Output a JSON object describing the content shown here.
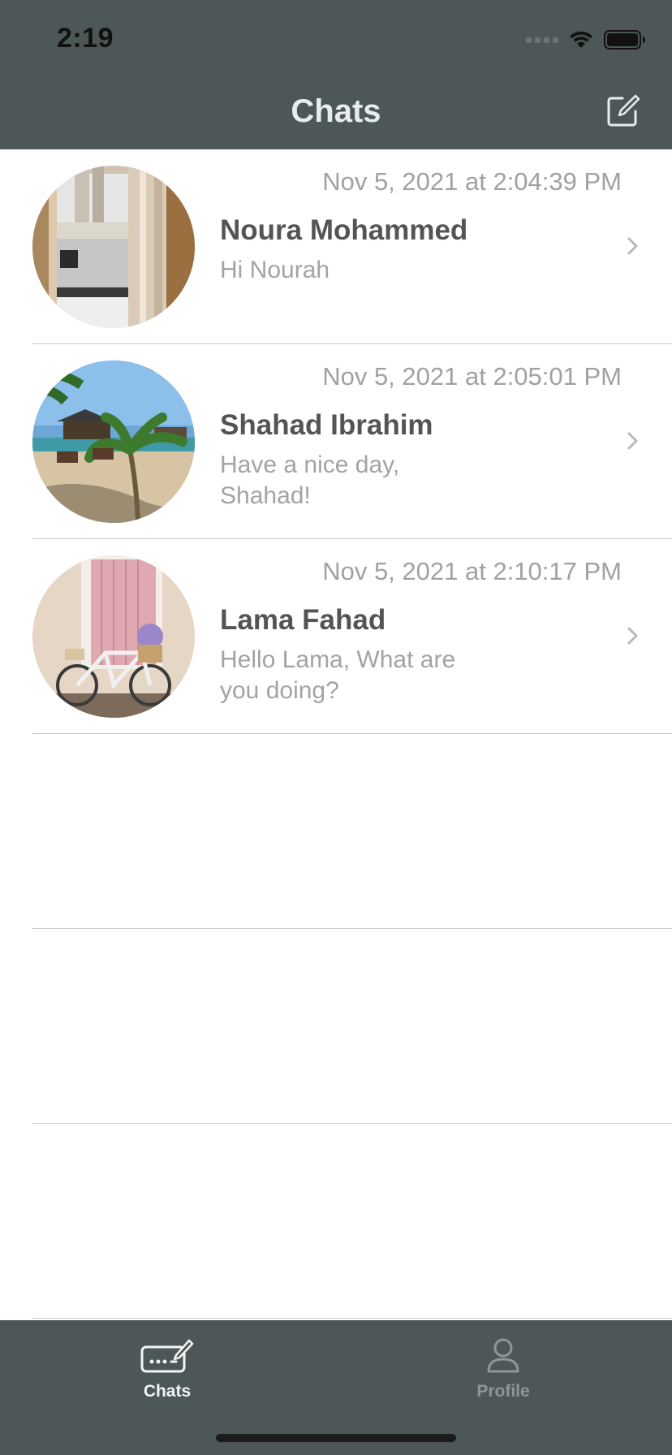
{
  "status_bar": {
    "time": "2:19"
  },
  "nav": {
    "title": "Chats",
    "compose_icon": "compose-icon"
  },
  "chats": [
    {
      "timestamp": "Nov 5, 2021 at 2:04:39 PM",
      "name": "Noura Mohammed",
      "message": "Hi Nourah"
    },
    {
      "timestamp": "Nov 5, 2021 at 2:05:01 PM",
      "name": "Shahad Ibrahim",
      "message": "Have a nice day, Shahad!"
    },
    {
      "timestamp": "Nov 5, 2021 at 2:10:17 PM",
      "name": "Lama Fahad",
      "message": "Hello Lama, What are you doing?"
    }
  ],
  "tab_bar": {
    "tabs": [
      {
        "label": "Chats",
        "icon": "chat-keyboard-icon",
        "selected": true
      },
      {
        "label": "Profile",
        "icon": "person-icon",
        "selected": false
      }
    ]
  },
  "colors": {
    "bar_background": "#4d5757",
    "title_text": "#e9ecec",
    "name_text": "#545454",
    "secondary_text": "#a3a3a3",
    "separator": "#c8c8c8"
  }
}
